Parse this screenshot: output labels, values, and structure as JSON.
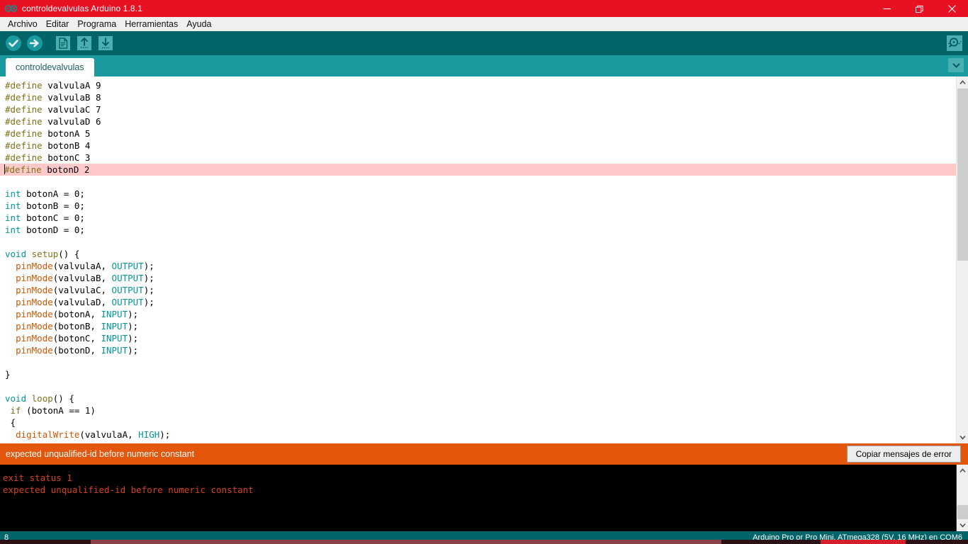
{
  "window": {
    "title": "controldevalvulas Arduino 1.8.1",
    "logo_icon": "arduino-infinity-logo",
    "minimize_icon": "minimize-icon",
    "restore_icon": "restore-icon",
    "close_icon": "close-icon"
  },
  "menubar": {
    "items": [
      {
        "label": "Archivo",
        "name": "menu-archivo"
      },
      {
        "label": "Editar",
        "name": "menu-editar"
      },
      {
        "label": "Programa",
        "name": "menu-programa"
      },
      {
        "label": "Herramientas",
        "name": "menu-herramientas"
      },
      {
        "label": "Ayuda",
        "name": "menu-ayuda"
      }
    ]
  },
  "toolbar": {
    "verify_label": "Verificar",
    "upload_label": "Subir",
    "new_label": "Nuevo",
    "open_label": "Abrir",
    "save_label": "Guardar",
    "serial_monitor_label": "Monitor Serie",
    "icons": {
      "verify": "check-circle-icon",
      "upload": "arrow-right-circle-icon",
      "new": "new-file-icon",
      "open": "arrow-up-icon",
      "save": "arrow-down-icon",
      "serial": "magnifier-icon"
    }
  },
  "tabs": {
    "active": "controldevalvulas",
    "items": [
      {
        "label": "controldevalvulas"
      }
    ],
    "menu_icon": "chevron-down-icon"
  },
  "editor": {
    "error_line_index": 7,
    "lines": [
      [
        {
          "t": "#define",
          "c": "pre"
        },
        {
          "t": " valvulaA 9",
          "c": "plain"
        }
      ],
      [
        {
          "t": "#define",
          "c": "pre"
        },
        {
          "t": " valvulaB 8",
          "c": "plain"
        }
      ],
      [
        {
          "t": "#define",
          "c": "pre"
        },
        {
          "t": " valvulaC 7",
          "c": "plain"
        }
      ],
      [
        {
          "t": "#define",
          "c": "pre"
        },
        {
          "t": " valvulaD 6",
          "c": "plain"
        }
      ],
      [
        {
          "t": "#define",
          "c": "pre"
        },
        {
          "t": " botonA 5",
          "c": "plain"
        }
      ],
      [
        {
          "t": "#define",
          "c": "pre"
        },
        {
          "t": " botonB 4",
          "c": "plain"
        }
      ],
      [
        {
          "t": "#define",
          "c": "pre"
        },
        {
          "t": " botonC 3",
          "c": "plain"
        }
      ],
      [
        {
          "t": "#define",
          "c": "pre"
        },
        {
          "t": " botonD 2",
          "c": "plain"
        }
      ],
      [],
      [
        {
          "t": "int",
          "c": "type"
        },
        {
          "t": " botonA = 0;",
          "c": "plain"
        }
      ],
      [
        {
          "t": "int",
          "c": "type"
        },
        {
          "t": " botonB = 0;",
          "c": "plain"
        }
      ],
      [
        {
          "t": "int",
          "c": "type"
        },
        {
          "t": " botonC = 0;",
          "c": "plain"
        }
      ],
      [
        {
          "t": "int",
          "c": "type"
        },
        {
          "t": " botonD = 0;",
          "c": "plain"
        }
      ],
      [],
      [
        {
          "t": "void",
          "c": "type"
        },
        {
          "t": " ",
          "c": "plain"
        },
        {
          "t": "setup",
          "c": "pre"
        },
        {
          "t": "() {",
          "c": "plain"
        }
      ],
      [
        {
          "t": "  ",
          "c": "plain"
        },
        {
          "t": "pinMode",
          "c": "fn"
        },
        {
          "t": "(valvulaA, ",
          "c": "plain"
        },
        {
          "t": "OUTPUT",
          "c": "type"
        },
        {
          "t": ");",
          "c": "plain"
        }
      ],
      [
        {
          "t": "  ",
          "c": "plain"
        },
        {
          "t": "pinMode",
          "c": "fn"
        },
        {
          "t": "(valvulaB, ",
          "c": "plain"
        },
        {
          "t": "OUTPUT",
          "c": "type"
        },
        {
          "t": ");",
          "c": "plain"
        }
      ],
      [
        {
          "t": "  ",
          "c": "plain"
        },
        {
          "t": "pinMode",
          "c": "fn"
        },
        {
          "t": "(valvulaC, ",
          "c": "plain"
        },
        {
          "t": "OUTPUT",
          "c": "type"
        },
        {
          "t": ");",
          "c": "plain"
        }
      ],
      [
        {
          "t": "  ",
          "c": "plain"
        },
        {
          "t": "pinMode",
          "c": "fn"
        },
        {
          "t": "(valvulaD, ",
          "c": "plain"
        },
        {
          "t": "OUTPUT",
          "c": "type"
        },
        {
          "t": ");",
          "c": "plain"
        }
      ],
      [
        {
          "t": "  ",
          "c": "plain"
        },
        {
          "t": "pinMode",
          "c": "fn"
        },
        {
          "t": "(botonA, ",
          "c": "plain"
        },
        {
          "t": "INPUT",
          "c": "type"
        },
        {
          "t": ");",
          "c": "plain"
        }
      ],
      [
        {
          "t": "  ",
          "c": "plain"
        },
        {
          "t": "pinMode",
          "c": "fn"
        },
        {
          "t": "(botonB, ",
          "c": "plain"
        },
        {
          "t": "INPUT",
          "c": "type"
        },
        {
          "t": ");",
          "c": "plain"
        }
      ],
      [
        {
          "t": "  ",
          "c": "plain"
        },
        {
          "t": "pinMode",
          "c": "fn"
        },
        {
          "t": "(botonC, ",
          "c": "plain"
        },
        {
          "t": "INPUT",
          "c": "type"
        },
        {
          "t": ");",
          "c": "plain"
        }
      ],
      [
        {
          "t": "  ",
          "c": "plain"
        },
        {
          "t": "pinMode",
          "c": "fn"
        },
        {
          "t": "(botonD, ",
          "c": "plain"
        },
        {
          "t": "INPUT",
          "c": "type"
        },
        {
          "t": ");",
          "c": "plain"
        }
      ],
      [],
      [
        {
          "t": "}",
          "c": "plain"
        }
      ],
      [],
      [
        {
          "t": "void",
          "c": "type"
        },
        {
          "t": " ",
          "c": "plain"
        },
        {
          "t": "loop",
          "c": "pre"
        },
        {
          "t": "() {",
          "c": "plain"
        }
      ],
      [
        {
          "t": " ",
          "c": "plain"
        },
        {
          "t": "if",
          "c": "pre"
        },
        {
          "t": " (botonA == 1)",
          "c": "plain"
        }
      ],
      [
        {
          "t": " {",
          "c": "plain"
        }
      ],
      [
        {
          "t": "  ",
          "c": "plain"
        },
        {
          "t": "digitalWrite",
          "c": "fn"
        },
        {
          "t": "(valvulaA, ",
          "c": "plain"
        },
        {
          "t": "HIGH",
          "c": "type"
        },
        {
          "t": ");",
          "c": "plain"
        }
      ]
    ]
  },
  "error_bar": {
    "message": "expected unqualified-id before numeric constant",
    "copy_button": "Copiar mensajes de error"
  },
  "console": {
    "lines": [
      "exit status 1",
      "expected unqualified-id before numeric constant"
    ]
  },
  "statusbar": {
    "line_number": "8",
    "board": "Arduino Pro or Pro Mini, ATmega328 (5V, 16 MHz) en COM6"
  },
  "colors": {
    "title_red": "#E81123",
    "toolbar_teal": "#006468",
    "tabbar_teal": "#1A9A9E",
    "error_orange": "#E4560B",
    "console_text": "#D9411E",
    "error_line_bg": "#FFC9C9",
    "kw_preprocessor": "#7E7219",
    "kw_type": "#00979C",
    "kw_function": "#D35400"
  }
}
